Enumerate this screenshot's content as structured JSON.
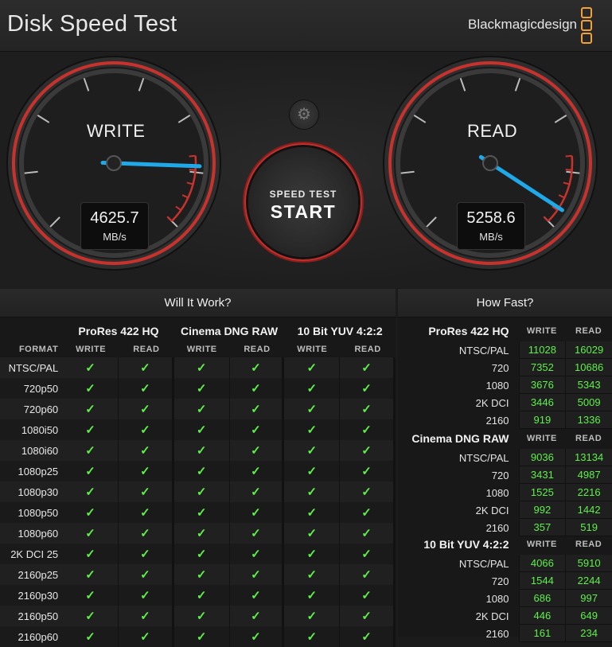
{
  "app": {
    "title": "Disk Speed Test",
    "brand": "Blackmagicdesign"
  },
  "gauges": {
    "write": {
      "label": "WRITE",
      "value": "4625.7",
      "unit": "MB/s"
    },
    "read": {
      "label": "READ",
      "value": "5258.6",
      "unit": "MB/s"
    }
  },
  "controls": {
    "settings_icon": "gear-icon",
    "start_small": "SPEED TEST",
    "start_big": "START"
  },
  "will_it_work": {
    "title": "Will It Work?",
    "format_header": "FORMAT",
    "groups": [
      "ProRes 422 HQ",
      "Cinema DNG RAW",
      "10 Bit YUV 4:2:2"
    ],
    "subcols": [
      "WRITE",
      "READ",
      "WRITE",
      "READ",
      "WRITE",
      "READ"
    ],
    "check_glyph": "✓",
    "rows": [
      "NTSC/PAL",
      "720p50",
      "720p60",
      "1080i50",
      "1080i60",
      "1080p25",
      "1080p30",
      "1080p50",
      "1080p60",
      "2K DCI 25",
      "2160p25",
      "2160p30",
      "2160p50",
      "2160p60"
    ]
  },
  "how_fast": {
    "title": "How Fast?",
    "write_label": "WRITE",
    "read_label": "READ",
    "groups": [
      {
        "name": "ProRes 422 HQ",
        "rows": [
          {
            "label": "NTSC/PAL",
            "write": "11028",
            "read": "16029"
          },
          {
            "label": "720",
            "write": "7352",
            "read": "10686"
          },
          {
            "label": "1080",
            "write": "3676",
            "read": "5343"
          },
          {
            "label": "2K DCI",
            "write": "3446",
            "read": "5009"
          },
          {
            "label": "2160",
            "write": "919",
            "read": "1336"
          }
        ]
      },
      {
        "name": "Cinema DNG RAW",
        "rows": [
          {
            "label": "NTSC/PAL",
            "write": "9036",
            "read": "13134"
          },
          {
            "label": "720",
            "write": "3431",
            "read": "4987"
          },
          {
            "label": "1080",
            "write": "1525",
            "read": "2216"
          },
          {
            "label": "2K DCI",
            "write": "992",
            "read": "1442"
          },
          {
            "label": "2160",
            "write": "357",
            "read": "519"
          }
        ]
      },
      {
        "name": "10 Bit YUV 4:2:2",
        "rows": [
          {
            "label": "NTSC/PAL",
            "write": "4066",
            "read": "5910"
          },
          {
            "label": "720",
            "write": "1544",
            "read": "2244"
          },
          {
            "label": "1080",
            "write": "686",
            "read": "997"
          },
          {
            "label": "2K DCI",
            "write": "446",
            "read": "649"
          },
          {
            "label": "2160",
            "write": "161",
            "read": "234"
          }
        ]
      }
    ]
  },
  "colors": {
    "accent_red": "#c8322d",
    "needle_blue": "#1fa9e8",
    "check_green": "#5ff04a",
    "brand_orange": "#f0a23a"
  }
}
